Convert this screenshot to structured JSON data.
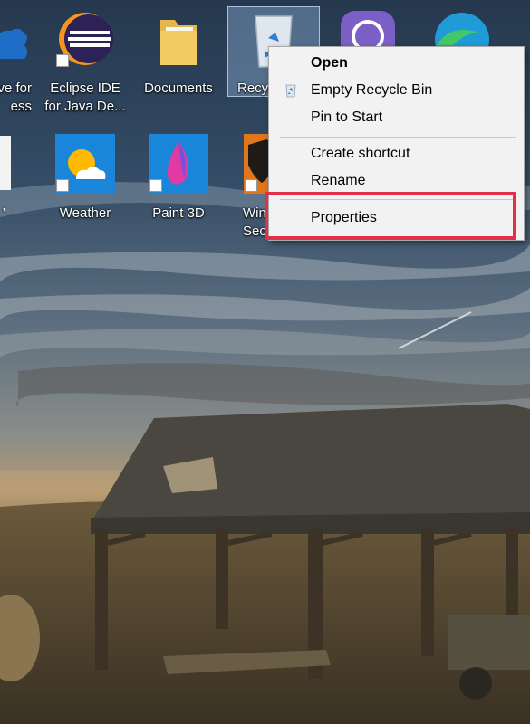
{
  "desktop": {
    "icons": [
      {
        "name": "onedrive-icon",
        "label_line1": "ve for",
        "label_line2": "ess"
      },
      {
        "name": "eclipse-icon",
        "label_line1": "Eclipse IDE",
        "label_line2": "for Java De..."
      },
      {
        "name": "documents-icon",
        "label_line1": "Documents"
      },
      {
        "name": "recycle-bin-icon",
        "label_line1": "Recyc"
      },
      {
        "name": "viber-icon"
      },
      {
        "name": "edge-icon"
      },
      {
        "name": "file-icon",
        "label_line1": "’"
      },
      {
        "name": "weather-icon",
        "label_line1": "Weather"
      },
      {
        "name": "paint3d-icon",
        "label_line1": "Paint 3D"
      },
      {
        "name": "windows-security-icon",
        "label_line1": "Win",
        "label_line2": "Sec"
      }
    ]
  },
  "context_menu": {
    "open": "Open",
    "empty_recycle_bin": "Empty Recycle Bin",
    "pin_to_start": "Pin to Start",
    "create_shortcut": "Create shortcut",
    "rename": "Rename",
    "properties": "Properties"
  },
  "colors": {
    "highlight": "#e0304a",
    "menu_bg": "#f2f2f2"
  }
}
